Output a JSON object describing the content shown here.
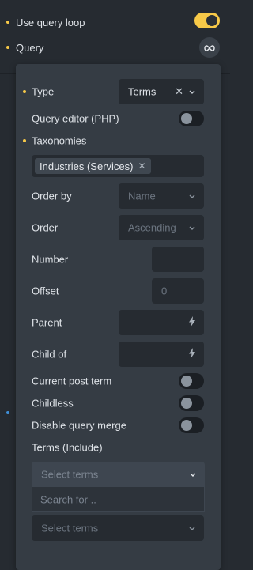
{
  "settings": {
    "use_query_loop": {
      "label": "Use query loop",
      "on": true
    },
    "query": {
      "label": "Query",
      "icon": "infinity-icon"
    }
  },
  "panel": {
    "type": {
      "label": "Type",
      "value": "Terms"
    },
    "query_editor": {
      "label": "Query editor (PHP)",
      "on": false
    },
    "taxonomies": {
      "label": "Taxonomies",
      "tags": [
        "Industries (Services)"
      ]
    },
    "order_by": {
      "label": "Order by",
      "value": "Name"
    },
    "order": {
      "label": "Order",
      "value": "Ascending"
    },
    "number": {
      "label": "Number",
      "value": ""
    },
    "offset": {
      "label": "Offset",
      "placeholder": "0"
    },
    "parent": {
      "label": "Parent",
      "icon": "dynamic-data-bolt-icon"
    },
    "child_of": {
      "label": "Child of",
      "icon": "dynamic-data-bolt-icon"
    },
    "current_post_term": {
      "label": "Current post term",
      "on": false
    },
    "childless": {
      "label": "Childless",
      "on": false
    },
    "disable_query_merge": {
      "label": "Disable query merge",
      "on": false
    },
    "terms_include": {
      "label": "Terms (Include)",
      "placeholder": "Select terms",
      "search_placeholder": "Search for .."
    },
    "terms_exclude": {
      "placeholder": "Select terms"
    }
  },
  "colors": {
    "accent": "#f7c948",
    "indicator_blue": "#3f8fd8",
    "panel_bg": "#353c44",
    "page_bg": "#262b31"
  }
}
